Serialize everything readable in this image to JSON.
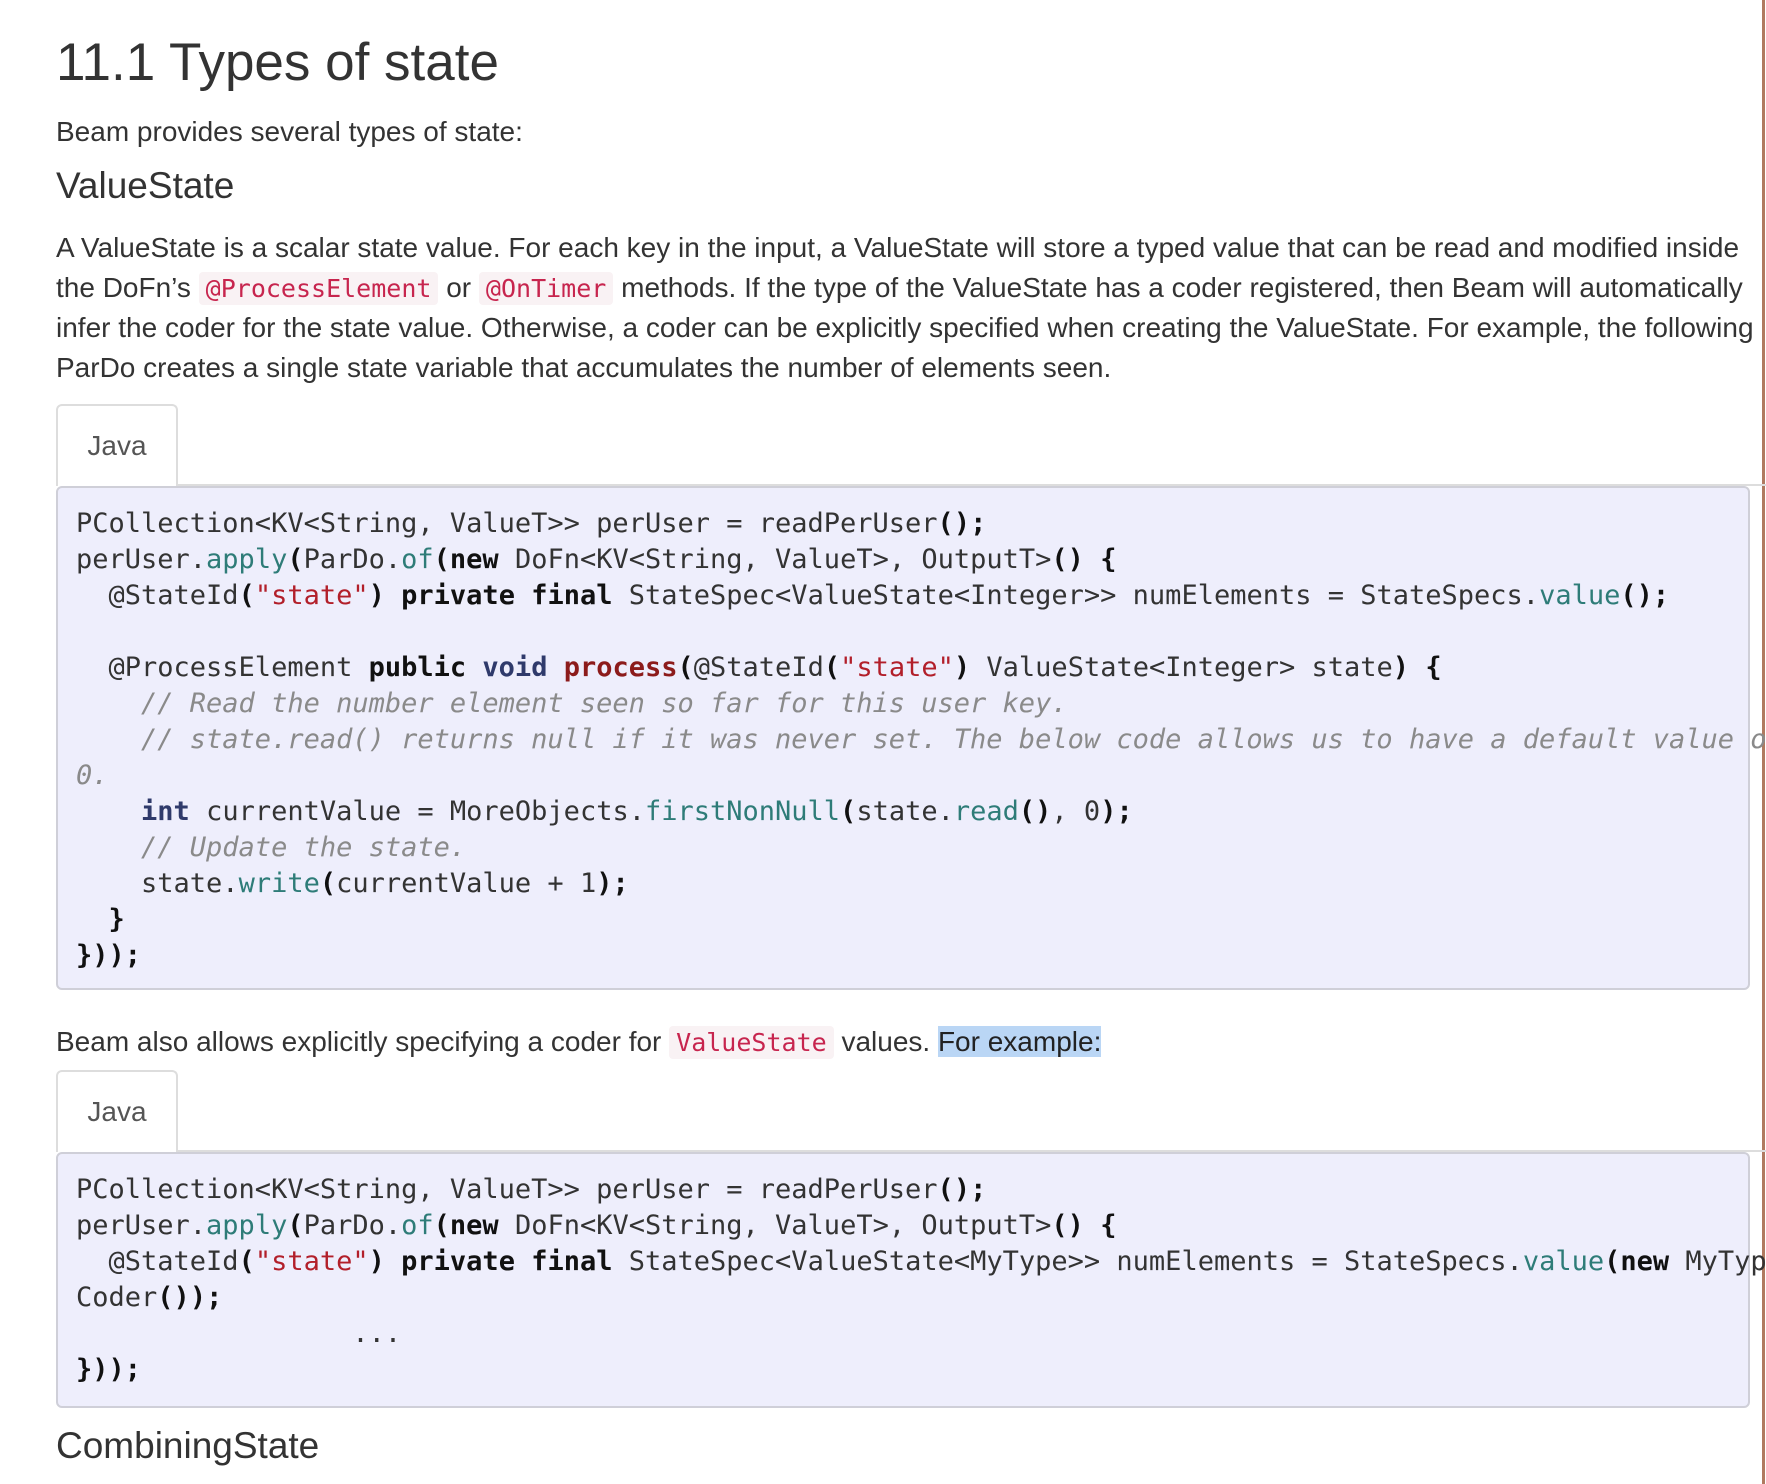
{
  "heading": "11.1 Types of state",
  "intro": "Beam provides several types of state:",
  "value_state": {
    "title": "ValueState",
    "desc_lines": [
      [
        "A ValueState is a scalar state value. For each key in the input, a ValueState will store a typed value that can be read and modified inside"
      ],
      [
        "the DoFn’s ",
        "@ProcessElement",
        " or ",
        "@OnTimer",
        " methods. If the type of the ValueState has a coder registered, then Beam will automatically"
      ],
      [
        "infer the coder for the state value. Otherwise, a coder can be explicitly specified when creating the ValueState. For example, the following"
      ],
      [
        "ParDo creates a single state variable that accumulates the number of elements seen."
      ]
    ],
    "tab_label": "Java"
  },
  "code1": [
    "PCollection<KV<String, ValueT>> perUser = readPerUser();",
    "perUser.apply(ParDo.of(new DoFn<KV<String, ValueT>, OutputT>() {",
    "  @StateId(\"state\") private final StateSpec<ValueState<Integer>> numElements = StateSpecs.value();",
    "",
    "  @ProcessElement public void process(@StateId(\"state\") ValueState<Integer> state) {",
    "    // Read the number element seen so far for this user key.",
    "    // state.read() returns null if it was never set. The below code allows us to have a default value of",
    "0.",
    "    int currentValue = MoreObjects.firstNonNull(state.read(), 0);",
    "    // Update the state.",
    "    state.write(currentValue + 1);",
    "  }",
    "}));"
  ],
  "para2": {
    "before": "Beam also allows explicitly specifying a coder for ",
    "code": "ValueState",
    "after": " values. ",
    "highlighted": "For example:"
  },
  "tab2_label": "Java",
  "code2": [
    "PCollection<KV<String, ValueT>> perUser = readPerUser();",
    "perUser.apply(ParDo.of(new DoFn<KV<String, ValueT>, OutputT>() {",
    "  @StateId(\"state\") private final StateSpec<ValueState<MyType>> numElements = StateSpecs.value(new MyType",
    "Coder());",
    "                 ...",
    "}));"
  ],
  "combining_state_title": "CombiningState",
  "colors": {
    "code_bg": "#eeeefc",
    "inline_code": "#c7254e",
    "string": "#b21f2a",
    "method": "#2e7c78",
    "comment": "#8a8a8a",
    "selection": "#bad6f5",
    "right_rule": "#b07a60"
  }
}
